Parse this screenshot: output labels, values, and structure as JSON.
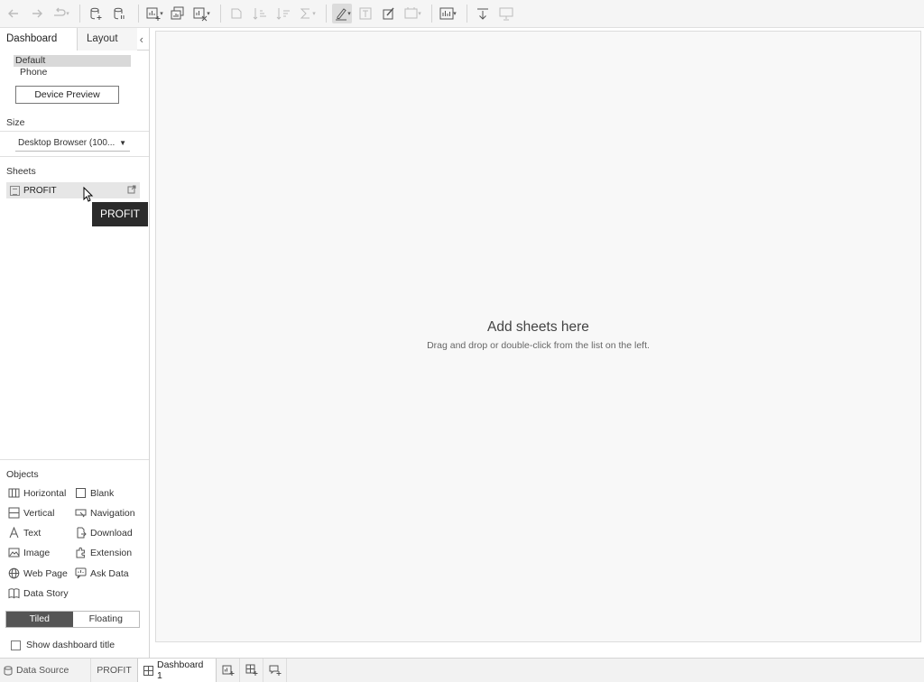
{
  "toolbar": {
    "icons": [
      "back-icon",
      "forward-icon",
      "redo-icon",
      "new-data-source-icon",
      "data-source-pause-icon",
      "new-worksheet-icon",
      "duplicate-sheet-icon",
      "clear-sheet-icon",
      "group-icon",
      "sort-ascending-icon",
      "sort-descending-icon",
      "totals-icon",
      "highlight-icon",
      "labels-icon",
      "annotate-icon",
      "fit-icon",
      "show-me-icon",
      "download-icon",
      "presentation-icon"
    ]
  },
  "left_panel": {
    "tabs": {
      "dashboard": "Dashboard",
      "layout": "Layout"
    },
    "collapse": "‹",
    "devices": {
      "default": "Default",
      "phone": "Phone",
      "preview_button": "Device Preview"
    },
    "size": {
      "label": "Size",
      "value": "Desktop Browser (100..."
    },
    "sheets": {
      "label": "Sheets",
      "items": [
        {
          "name": "PROFIT"
        }
      ]
    },
    "tooltip": "PROFIT",
    "objects": {
      "label": "Objects",
      "items": [
        {
          "label": "Horizontal"
        },
        {
          "label": "Blank"
        },
        {
          "label": "Vertical"
        },
        {
          "label": "Navigation"
        },
        {
          "label": "Text"
        },
        {
          "label": "Download"
        },
        {
          "label": "Image"
        },
        {
          "label": "Extension"
        },
        {
          "label": "Web Page"
        },
        {
          "label": "Ask Data"
        },
        {
          "label": "Data Story"
        }
      ]
    },
    "mode": {
      "tiled": "Tiled",
      "floating": "Floating",
      "selected": "Tiled"
    },
    "show_title": {
      "label": "Show dashboard title",
      "checked": false
    }
  },
  "canvas": {
    "title": "Add sheets here",
    "hint": "Drag and drop or double-click from the list on the left."
  },
  "bottom_tabs": {
    "data_source": "Data Source",
    "sheet": "PROFIT",
    "dashboard": "Dashboard 1",
    "actions": [
      "new-worksheet-icon",
      "new-dashboard-icon",
      "new-story-icon"
    ]
  },
  "colors": {
    "toolbar_bg": "#f5f5f5",
    "selected_mode_bg": "#555555",
    "tooltip_bg": "#2b2b2b",
    "canvas_bg": "#f8f8f8"
  }
}
